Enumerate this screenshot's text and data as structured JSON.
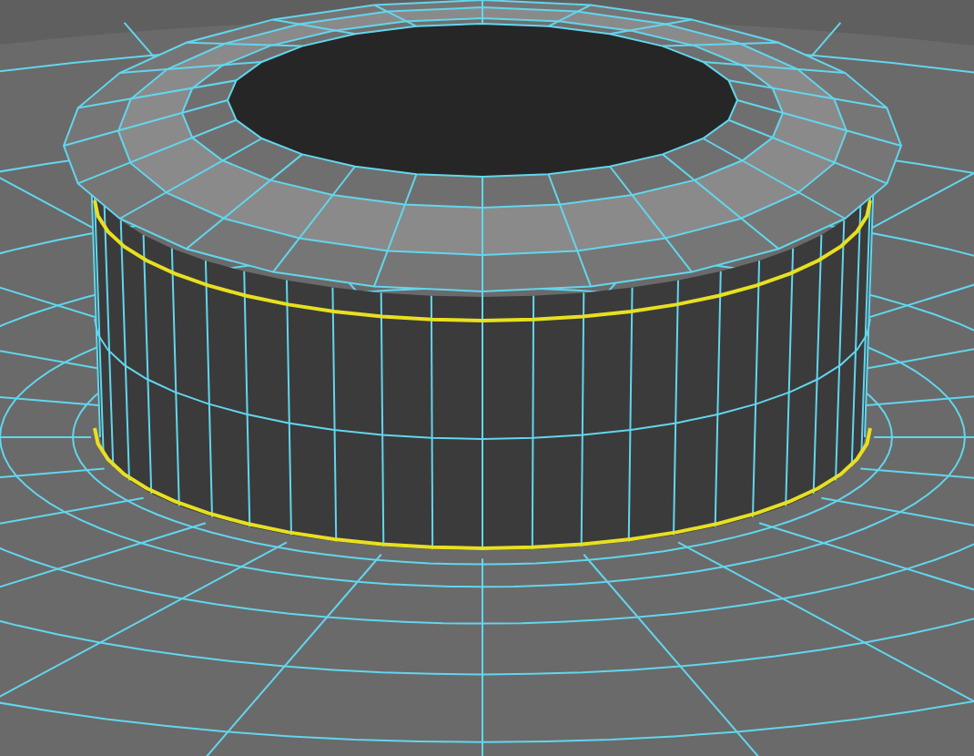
{
  "viewport": {
    "edge_loops": [
      {
        "selected": true
      },
      {
        "selected": false
      },
      {
        "selected": true
      }
    ]
  }
}
